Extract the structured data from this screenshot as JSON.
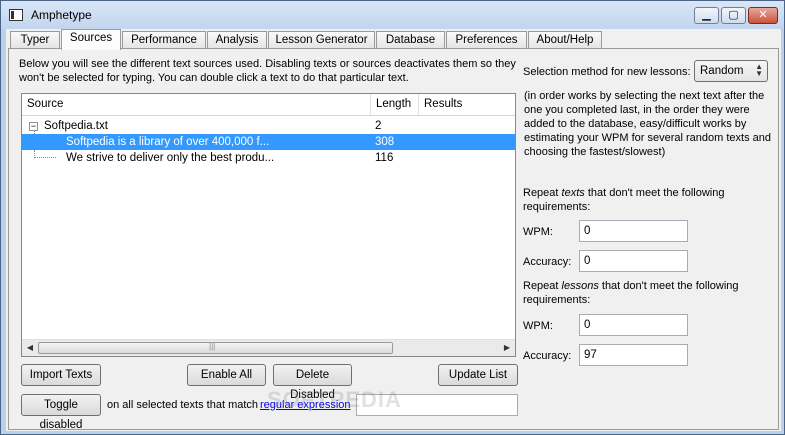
{
  "window": {
    "title": "Amphetype",
    "controls": {
      "minimize": "▁",
      "maximize": "▢",
      "close": "✕"
    }
  },
  "tabs": [
    {
      "label": "Typer"
    },
    {
      "label": "Sources"
    },
    {
      "label": "Performance"
    },
    {
      "label": "Analysis"
    },
    {
      "label": "Lesson Generator"
    },
    {
      "label": "Database"
    },
    {
      "label": "Preferences"
    },
    {
      "label": "About/Help"
    }
  ],
  "active_tab": "Sources",
  "sources": {
    "description": "Below you will see the different text sources used. Disabling texts or sources deactivates them so they won't be selected for typing. You can double click a text to do that particular text.",
    "columns": [
      "Source",
      "Length",
      "Results"
    ],
    "rows": [
      {
        "source": "Softpedia.txt",
        "length": "2",
        "results": ""
      },
      {
        "source": "Softpedia is a library of over 400,000 f...",
        "length": "308",
        "results": ""
      },
      {
        "source": "We strive to deliver only the best produ...",
        "length": "116",
        "results": ""
      }
    ],
    "expander_symbol": "−"
  },
  "buttons": {
    "import": "Import Texts",
    "enable_all": "Enable All",
    "delete_disabled": "Delete Disabled",
    "update_list": "Update List",
    "toggle_disabled": "Toggle disabled"
  },
  "toggle_row": {
    "text": "on all selected texts that match",
    "link": "regular expression",
    "regex_value": ""
  },
  "settings": {
    "selection_label": "Selection method for new lessons:",
    "selection_value": "Random",
    "selection_help": "(in order works by selecting the next text after the one you completed last, in the order they were added to the database, easy/difficult works by estimating your WPM for several random texts and choosing the fastest/slowest)",
    "texts_repeat_pre": "Repeat ",
    "texts_repeat_em": "texts",
    "texts_repeat_post": " that don't meet the following requirements:",
    "texts_wpm_label": "WPM:",
    "texts_wpm_value": "0",
    "texts_acc_label": "Accuracy:",
    "texts_acc_value": "0",
    "lessons_repeat_pre": "Repeat ",
    "lessons_repeat_em": "lessons",
    "lessons_repeat_post": " that don't meet the following requirements:",
    "lessons_wpm_label": "WPM:",
    "lessons_wpm_value": "0",
    "lessons_acc_label": "Accuracy:",
    "lessons_acc_value": "97"
  },
  "scrollbar": {
    "left_arrow": "◀",
    "right_arrow": "▶",
    "grip": "|||"
  },
  "watermark": "SOFTPEDIA"
}
